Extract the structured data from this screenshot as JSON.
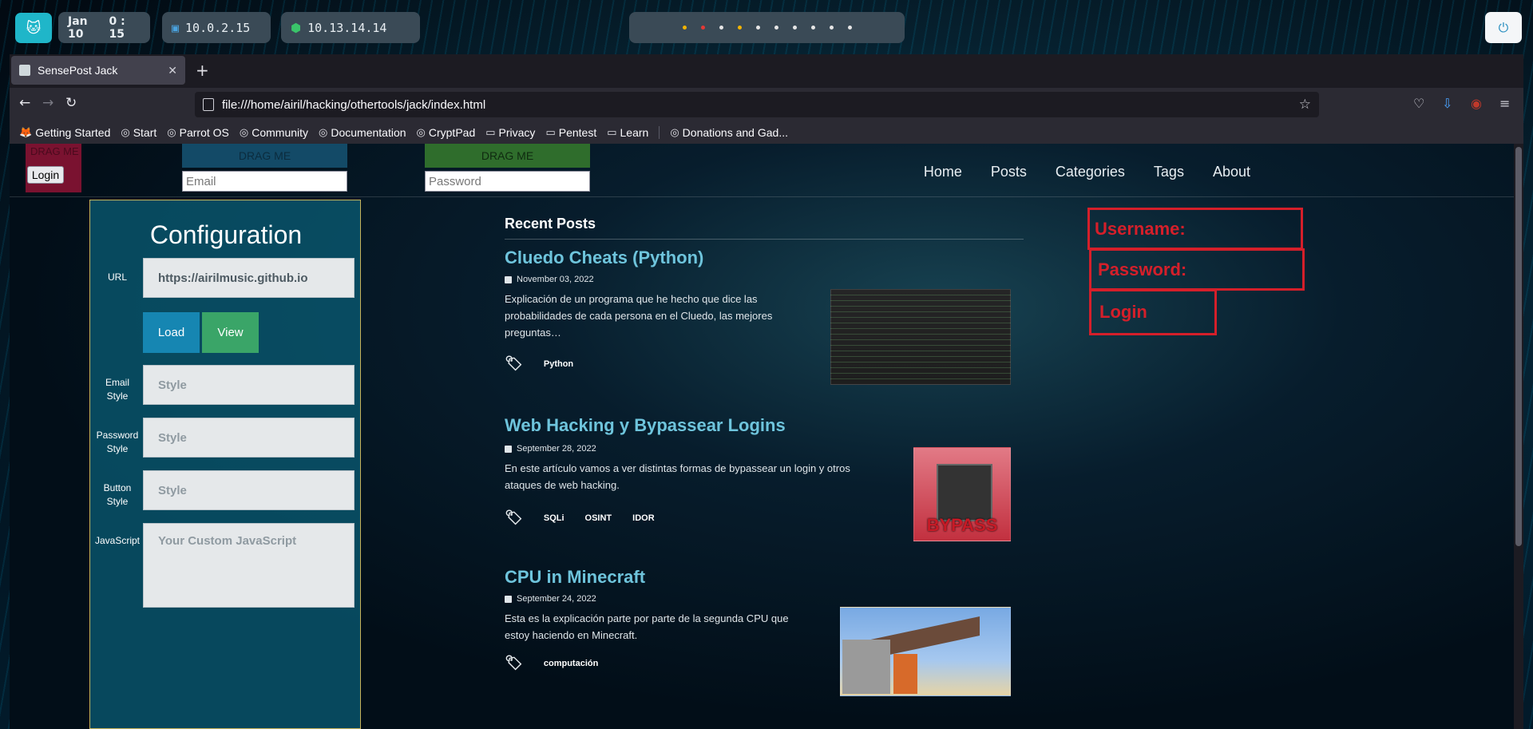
{
  "system": {
    "date": "Jan 10",
    "time": "0 : 15",
    "ip1": "10.0.2.15",
    "ip2": "10.13.14.14",
    "workspace_dot_colors": [
      "#f4b400",
      "#e53935",
      "#e6e6e6",
      "#f4b400",
      "#e6e6e6",
      "#e6e6e6",
      "#e6e6e6",
      "#e6e6e6",
      "#e6e6e6",
      "#e6e6e6"
    ]
  },
  "browser": {
    "tab_title": "SensePost Jack",
    "url": "file:///home/airil/hacking/othertools/jack/index.html",
    "bookmarks": [
      "Getting Started",
      "Start",
      "Parrot OS",
      "Community",
      "Documentation",
      "CryptPad",
      "Privacy",
      "Pentest",
      "Learn",
      "Donations and Gad..."
    ]
  },
  "injected": {
    "login_label": "DRAG ME",
    "login_button": "Login",
    "email_drag_label": "DRAG ME",
    "email_placeholder": "Email",
    "password_drag_label": "DRAG ME",
    "password_placeholder": "Password"
  },
  "site": {
    "nav": [
      "Home",
      "Posts",
      "Categories",
      "Tags",
      "About"
    ],
    "recent_posts_heading": "Recent Posts",
    "posts": [
      {
        "title": "Cluedo Cheats (Python)",
        "date": "November 03, 2022",
        "description": "Explicación de un programa que he hecho que dice las probabilidades de cada persona en el Cluedo, las mejores preguntas…",
        "tags": [
          "Python"
        ]
      },
      {
        "title": "Web Hacking y Bypassear Logins",
        "date": "September 28, 2022",
        "description": "En este artículo vamos a ver distintas formas de bypassear un login y otros ataques de web hacking.",
        "tags": [
          "SQLi",
          "OSINT",
          "IDOR"
        ],
        "thumb_text": "BYPASS"
      },
      {
        "title": "CPU in Minecraft",
        "date": "September 24, 2022",
        "description": "Esta es la explicación parte por parte de la segunda CPU que estoy haciendo en Minecraft.",
        "tags": [
          "computación"
        ]
      }
    ]
  },
  "config": {
    "title": "Configuration",
    "url_label": "URL",
    "url_value": "https://airilmusic.github.io",
    "load_button": "Load",
    "view_button": "View",
    "email_style_label": "Email Style",
    "password_style_label": "Password Style",
    "button_style_label": "Button Style",
    "style_placeholder": "Style",
    "javascript_label": "JavaScript",
    "javascript_placeholder": "Your Custom JavaScript"
  },
  "overlay_form": {
    "username_label": "Username:",
    "password_label": "Password:",
    "login_label": "Login"
  },
  "colors": {
    "accent_cyan": "#1fb6c9",
    "post_title": "#6ec4dc",
    "overlay_red": "#d51f2a",
    "load_btn": "#1686b2",
    "view_btn": "#3aa568"
  }
}
